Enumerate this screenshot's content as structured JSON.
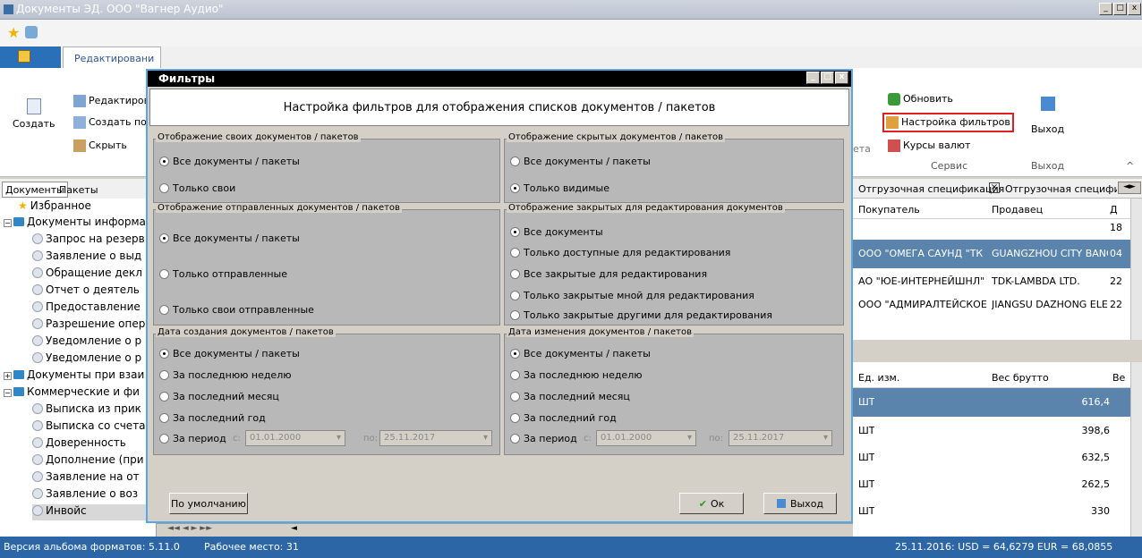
{
  "window": {
    "title": "Документы ЭД. ООО \"Вагнер Аудио\"",
    "min": "_",
    "max": "□",
    "close": "x"
  },
  "ribbon": {
    "tab_active": "Редактировани",
    "create_label": "Создать",
    "edit_label": "Редактиров",
    "create_from_label": "Создать по",
    "hide_label": "Скрыть",
    "cut_label": "ета",
    "refresh_label": "Обновить",
    "filter_settings_label": "Настройка фильтров",
    "currency_label": "Курсы валют",
    "service_group": "Сервис",
    "exit_label": "Выход",
    "exit_group": "Выход"
  },
  "left_tabs": {
    "docs": "Документы",
    "packets": "Пакеты"
  },
  "tree": [
    {
      "label": "Избранное"
    },
    {
      "label": "Документы информа"
    },
    {
      "label": "Запрос на резерв"
    },
    {
      "label": "Заявление о выд"
    },
    {
      "label": "Обращение декл"
    },
    {
      "label": "Отчет о деятель"
    },
    {
      "label": "Предоставление"
    },
    {
      "label": "Разрешение опер"
    },
    {
      "label": "Уведомление о р"
    },
    {
      "label": "Уведомление о р"
    },
    {
      "label": "Документы при взаи"
    },
    {
      "label": "Коммерческие и фи"
    },
    {
      "label": "Выписка из прик"
    },
    {
      "label": "Выписка со счета"
    },
    {
      "label": "Доверенность"
    },
    {
      "label": "Дополнение (при"
    },
    {
      "label": "Заявление на от"
    },
    {
      "label": "Заявление о воз"
    },
    {
      "label": "Инвойс"
    }
  ],
  "grid_tabs": [
    "Отгрузочная спецификация",
    "Отгрузочная специфик"
  ],
  "grid1": {
    "headers": [
      "Покупатель",
      "Продавец",
      "Д"
    ],
    "rows": [
      {
        "buyer": "",
        "seller": "",
        "d": "18"
      },
      {
        "buyer": "ООО \"ОМЕГА САУНД \"ТК",
        "seller": "GUANGZHOU CITY BANQU",
        "d": "04"
      },
      {
        "buyer": "АО \"ЮЕ-ИНТЕРНЕЙШНЛ\"",
        "seller": "TDK-LAMBDA LTD.",
        "d": "22"
      },
      {
        "buyer": "ООО \"АДМИРАЛТЕЙСКОЕ",
        "seller": "JIANGSU DAZHONG ELECT",
        "d": "22"
      }
    ]
  },
  "grid2": {
    "headers": [
      "Ед. изм.",
      "Вес брутто",
      "Ве"
    ],
    "rows": [
      {
        "unit": "ШТ",
        "weight": "616,4"
      },
      {
        "unit": "ШТ",
        "weight": "398,6"
      },
      {
        "unit": "ШТ",
        "weight": "632,5"
      },
      {
        "unit": "ШТ",
        "weight": "262,5"
      },
      {
        "unit": "ШТ",
        "weight": "330"
      }
    ]
  },
  "status": {
    "album": "Версия альбома форматов: 5.11.0",
    "workplace": "Рабочее место: 31",
    "rates": "25.11.2016:  USD = 64,6279  EUR = 68,0855"
  },
  "dialog": {
    "title": "Фильтры",
    "header": "Настройка фильтров для отображения списков документов / пакетов",
    "g1": {
      "caption": "Отображение своих документов / пакетов",
      "opts": [
        "Все документы / пакеты",
        "Только свои"
      ]
    },
    "g2": {
      "caption": "Отображение скрытых документов / пакетов",
      "opts": [
        "Все документы / пакеты",
        "Только видимые"
      ]
    },
    "g3": {
      "caption": "Отображение отправленных документов / пакетов",
      "opts": [
        "Все документы / пакеты",
        "Только отправленные",
        "Только свои отправленные"
      ]
    },
    "g4": {
      "caption": "Отображение закрытых для редактирования документов",
      "opts": [
        "Все документы",
        "Только доступные для редактирования",
        "Все закрытые для редактирования",
        "Только закрытые мной для редактирования",
        "Только закрытые другими для редактирования"
      ]
    },
    "g5": {
      "caption": "Дата создания документов / пакетов",
      "opts": [
        "Все документы / пакеты",
        "За последнюю неделю",
        "За последний месяц",
        "За последний год",
        "За период"
      ],
      "from_label": "с:",
      "from": "01.01.2000",
      "to_label": "по:",
      "to": "25.11.2017"
    },
    "g6": {
      "caption": "Дата изменения документов / пакетов",
      "opts": [
        "Все документы / пакеты",
        "За последнюю неделю",
        "За последний месяц",
        "За последний год",
        "За период"
      ],
      "from_label": "с:",
      "from": "01.01.2000",
      "to_label": "по:",
      "to": "25.11.2017"
    },
    "default_btn": "По умолчанию",
    "ok_btn": "Ок",
    "exit_btn": "Выход"
  }
}
